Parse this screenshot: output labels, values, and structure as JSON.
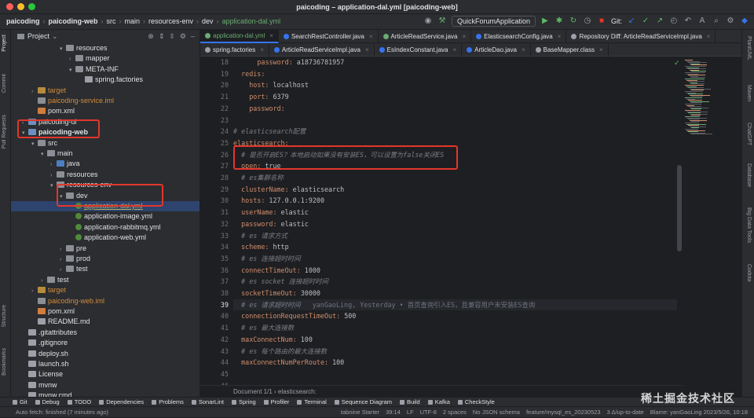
{
  "window": {
    "title": "paicoding – application-dal.yml [paicoding-web]"
  },
  "navbar": {
    "breadcrumbs": [
      "paicoding",
      "paicoding-web",
      "src",
      "main",
      "resources-env",
      "dev",
      "application-dal.yml"
    ],
    "run_config": "QuickForumApplication",
    "git_label": "Git:"
  },
  "left_strip": [
    "Project",
    "Commit",
    "Pull Requests",
    "Structure",
    "Bookmarks"
  ],
  "right_strip": [
    "PlantUML",
    "Maven",
    "ChatGPT",
    "Database",
    "Big Data Tools",
    "Codota"
  ],
  "project": {
    "header": "Project",
    "tree": [
      {
        "label": "resources",
        "indent": 6,
        "arrow": "▾",
        "icon": "folder",
        "color": ""
      },
      {
        "label": "mapper",
        "indent": 7,
        "arrow": "›",
        "icon": "folder",
        "color": ""
      },
      {
        "label": "META-INF",
        "indent": 7,
        "arrow": "▾",
        "icon": "folder",
        "color": ""
      },
      {
        "label": "spring.factories",
        "indent": 8,
        "arrow": "",
        "icon": "txt",
        "color": ""
      },
      {
        "label": "target",
        "indent": 3,
        "arrow": "›",
        "icon": "folder y",
        "color": "c-orange"
      },
      {
        "label": "paicoding-service.iml",
        "indent": 3,
        "arrow": "",
        "icon": "iml",
        "color": "c-orange"
      },
      {
        "label": "pom.xml",
        "indent": 3,
        "arrow": "",
        "icon": "xml",
        "color": ""
      },
      {
        "label": "paicoding-ui",
        "indent": 2,
        "arrow": "›",
        "icon": "mod",
        "color": ""
      },
      {
        "label": "paicoding-web",
        "indent": 2,
        "arrow": "▾",
        "icon": "mod",
        "color": "b"
      },
      {
        "label": "src",
        "indent": 3,
        "arrow": "▾",
        "icon": "folder",
        "color": ""
      },
      {
        "label": "main",
        "indent": 4,
        "arrow": "▾",
        "icon": "folder",
        "color": ""
      },
      {
        "label": "java",
        "indent": 5,
        "arrow": "›",
        "icon": "folder b",
        "color": ""
      },
      {
        "label": "resources",
        "indent": 5,
        "arrow": "›",
        "icon": "folder",
        "color": ""
      },
      {
        "label": "resources-env",
        "indent": 5,
        "arrow": "▾",
        "icon": "folder",
        "color": ""
      },
      {
        "label": "dev",
        "indent": 6,
        "arrow": "▾",
        "icon": "folder",
        "color": ""
      },
      {
        "label": "application-dal.yml",
        "indent": 7,
        "arrow": "",
        "icon": "yml",
        "color": "c-olive sel"
      },
      {
        "label": "application-image.yml",
        "indent": 7,
        "arrow": "",
        "icon": "yml",
        "color": ""
      },
      {
        "label": "application-rabbitmq.yml",
        "indent": 7,
        "arrow": "",
        "icon": "yml",
        "color": ""
      },
      {
        "label": "application-web.yml",
        "indent": 7,
        "arrow": "",
        "icon": "yml",
        "color": ""
      },
      {
        "label": "pre",
        "indent": 6,
        "arrow": "›",
        "icon": "folder",
        "color": ""
      },
      {
        "label": "prod",
        "indent": 6,
        "arrow": "›",
        "icon": "folder",
        "color": ""
      },
      {
        "label": "test",
        "indent": 6,
        "arrow": "›",
        "icon": "folder",
        "color": ""
      },
      {
        "label": "test",
        "indent": 4,
        "arrow": "›",
        "icon": "folder",
        "color": ""
      },
      {
        "label": "target",
        "indent": 3,
        "arrow": "›",
        "icon": "folder y",
        "color": "c-orange"
      },
      {
        "label": "paicoding-web.iml",
        "indent": 3,
        "arrow": "",
        "icon": "iml",
        "color": "c-orange"
      },
      {
        "label": "pom.xml",
        "indent": 3,
        "arrow": "",
        "icon": "xml",
        "color": ""
      },
      {
        "label": "README.md",
        "indent": 3,
        "arrow": "",
        "icon": "txt",
        "color": ""
      },
      {
        "label": ".gitattributes",
        "indent": 2,
        "arrow": "",
        "icon": "txt",
        "color": ""
      },
      {
        "label": ".gitignore",
        "indent": 2,
        "arrow": "",
        "icon": "txt",
        "color": ""
      },
      {
        "label": "deploy.sh",
        "indent": 2,
        "arrow": "",
        "icon": "txt",
        "color": ""
      },
      {
        "label": "launch.sh",
        "indent": 2,
        "arrow": "",
        "icon": "txt",
        "color": ""
      },
      {
        "label": "License",
        "indent": 2,
        "arrow": "",
        "icon": "txt",
        "color": ""
      },
      {
        "label": "mvnw",
        "indent": 2,
        "arrow": "",
        "icon": "txt",
        "color": ""
      },
      {
        "label": "mvnw.cmd",
        "indent": 2,
        "arrow": "",
        "icon": "txt",
        "color": ""
      }
    ]
  },
  "tabs_row1": [
    {
      "label": "application-dal.yml",
      "active": true,
      "color": "#6aab73"
    },
    {
      "label": "SearchRestController.java",
      "active": false,
      "color": "#3574f0"
    },
    {
      "label": "ArticleReadService.java",
      "active": false,
      "color": "#6aab73"
    },
    {
      "label": "ElasticsearchConfig.java",
      "active": false,
      "color": "#3574f0"
    },
    {
      "label": "Repository Diff: ArticleReadServiceImpl.java",
      "active": false,
      "color": "#9da0a8"
    }
  ],
  "tabs_row2": [
    {
      "label": "spring.factories",
      "active": false,
      "color": "#9da0a8"
    },
    {
      "label": "ArticleReadServiceImpl.java",
      "active": false,
      "color": "#3574f0"
    },
    {
      "label": "EsIndexConstant.java",
      "active": false,
      "color": "#3574f0"
    },
    {
      "label": "ArticleDao.java",
      "active": false,
      "color": "#3574f0"
    },
    {
      "label": "BaseMapper.class",
      "active": false,
      "color": "#9da0a8"
    }
  ],
  "code": [
    {
      "n": "18",
      "indent": 6,
      "key": "password:",
      "val": " a18736781957",
      "comment": ""
    },
    {
      "n": "19",
      "indent": 2,
      "key": "redis:",
      "val": "",
      "comment": ""
    },
    {
      "n": "20",
      "indent": 4,
      "key": "host:",
      "val": " localhost",
      "comment": ""
    },
    {
      "n": "21",
      "indent": 4,
      "key": "port:",
      "val": " 6379",
      "comment": ""
    },
    {
      "n": "22",
      "indent": 4,
      "key": "password:",
      "val": "",
      "comment": ""
    },
    {
      "n": "23",
      "indent": 0,
      "key": "",
      "val": "",
      "comment": ""
    },
    {
      "n": "24",
      "indent": 0,
      "key": "",
      "val": "",
      "comment": "# elasticsearch配置"
    },
    {
      "n": "25",
      "indent": 0,
      "key": "elasticsearch:",
      "val": "",
      "comment": ""
    },
    {
      "n": "26",
      "indent": 2,
      "key": "",
      "val": "",
      "comment": "# 是否开启ES？本地启动如果没有安装ES，可以设置为false关闭ES"
    },
    {
      "n": "27",
      "indent": 2,
      "key": "open:",
      "val": " true",
      "comment": ""
    },
    {
      "n": "28",
      "indent": 2,
      "key": "",
      "val": "",
      "comment": "# es集群名称"
    },
    {
      "n": "29",
      "indent": 2,
      "key": "clusterName:",
      "val": " elasticsearch",
      "comment": ""
    },
    {
      "n": "30",
      "indent": 2,
      "key": "hosts:",
      "val": " 127.0.0.1:9200",
      "comment": ""
    },
    {
      "n": "31",
      "indent": 2,
      "key": "userName:",
      "val": " elastic",
      "comment": ""
    },
    {
      "n": "32",
      "indent": 2,
      "key": "password:",
      "val": " elastic",
      "comment": ""
    },
    {
      "n": "33",
      "indent": 2,
      "key": "",
      "val": "",
      "comment": "# es 请求方式"
    },
    {
      "n": "34",
      "indent": 2,
      "key": "scheme:",
      "val": " http",
      "comment": ""
    },
    {
      "n": "35",
      "indent": 2,
      "key": "",
      "val": "",
      "comment": "# es 连接超时时间"
    },
    {
      "n": "36",
      "indent": 2,
      "key": "connectTimeOut:",
      "val": " 1000",
      "comment": ""
    },
    {
      "n": "37",
      "indent": 2,
      "key": "",
      "val": "",
      "comment": "# es socket 连接超时时间"
    },
    {
      "n": "38",
      "indent": 2,
      "key": "socketTimeOut:",
      "val": " 30000",
      "comment": ""
    },
    {
      "n": "39",
      "indent": 2,
      "key": "",
      "val": "",
      "comment": "# es 请求超时时间",
      "blame": "   yanGaoLing, Yesterday • 首页查询引入ES，且兼容用户未安装ES查询"
    },
    {
      "n": "40",
      "indent": 2,
      "key": "connectionRequestTimeOut:",
      "val": " 500",
      "comment": ""
    },
    {
      "n": "41",
      "indent": 2,
      "key": "",
      "val": "",
      "comment": "# es 最大连接数"
    },
    {
      "n": "42",
      "indent": 2,
      "key": "maxConnectNum:",
      "val": " 100",
      "comment": ""
    },
    {
      "n": "43",
      "indent": 2,
      "key": "",
      "val": "",
      "comment": "# es 每个路由的最大连接数"
    },
    {
      "n": "44",
      "indent": 2,
      "key": "maxConnectNumPerRoute:",
      "val": " 100",
      "comment": ""
    },
    {
      "n": "45",
      "indent": 0,
      "key": "",
      "val": "",
      "comment": ""
    },
    {
      "n": "46",
      "indent": 0,
      "key": "",
      "val": "",
      "comment": ""
    },
    {
      "n": "47",
      "indent": 0,
      "key": "",
      "val": "",
      "comment": ""
    }
  ],
  "editor_breadcrumb": "Document 1/1  ›  elasticsearch:",
  "tool_windows": [
    "Git",
    "Debug",
    "TODO",
    "Dependencies",
    "Problems",
    "SonarLint",
    "Spring",
    "Profiler",
    "Terminal",
    "Sequence Diagram",
    "Build",
    "Kafka",
    "CheckStyle"
  ],
  "status": {
    "left": "Auto fetch: finished (7 minutes ago)",
    "right": [
      "tabnine Starter",
      "39:14",
      "LF",
      "UTF-8",
      "2 spaces",
      "No JSON schema",
      "feature/mysql_es_20230523",
      "3 Δ/up-to-date",
      "Blame: yanGaoLing 2023/5/26, 10:18"
    ]
  },
  "watermark": "稀土掘金技术社区",
  "colors": {
    "accent": "#3574f0",
    "highlight": "#e3362c"
  }
}
